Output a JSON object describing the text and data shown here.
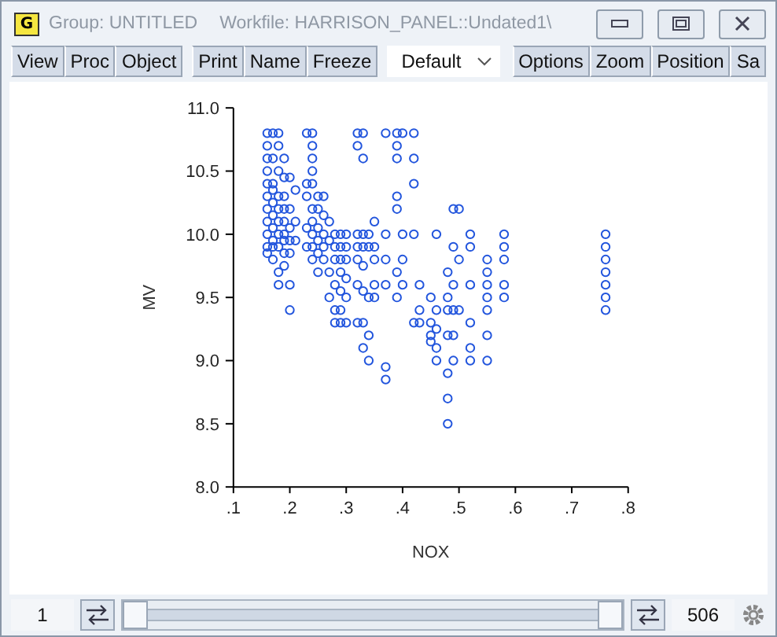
{
  "window": {
    "app_badge": "G",
    "title": "Group: UNTITLED",
    "workfile": "Workfile: HARRISON_PANEL::Undated1\\"
  },
  "toolbar": {
    "groups": [
      [
        {
          "label": "View"
        },
        {
          "label": "Proc"
        },
        {
          "label": "Object"
        }
      ],
      [
        {
          "label": "Print"
        },
        {
          "label": "Name"
        },
        {
          "label": "Freeze"
        }
      ]
    ],
    "dropdown": {
      "value": "Default"
    },
    "right": [
      {
        "label": "Options"
      },
      {
        "label": "Zoom"
      },
      {
        "label": "Position"
      },
      {
        "label": "Sa"
      }
    ]
  },
  "graph": {
    "chart_data": {
      "type": "scatter",
      "xlabel": "NOX",
      "ylabel": "MV",
      "xlim": [
        0.1,
        0.8
      ],
      "ylim": [
        8.0,
        11.0
      ],
      "xticks": [
        {
          "value": 0.1,
          "label": ".1"
        },
        {
          "value": 0.2,
          "label": ".2"
        },
        {
          "value": 0.3,
          "label": ".3"
        },
        {
          "value": 0.4,
          "label": ".4"
        },
        {
          "value": 0.5,
          "label": ".5"
        },
        {
          "value": 0.6,
          "label": ".6"
        },
        {
          "value": 0.7,
          "label": ".7"
        },
        {
          "value": 0.8,
          "label": ".8"
        }
      ],
      "yticks": [
        {
          "value": 8.0,
          "label": "8.0"
        },
        {
          "value": 8.5,
          "label": "8.5"
        },
        {
          "value": 9.0,
          "label": "9.0"
        },
        {
          "value": 9.5,
          "label": "9.5"
        },
        {
          "value": 10.0,
          "label": "10.0"
        },
        {
          "value": 10.5,
          "label": "10.5"
        },
        {
          "value": 11.0,
          "label": "11.0"
        }
      ],
      "x": [
        0.16,
        0.16,
        0.16,
        0.16,
        0.16,
        0.16,
        0.16,
        0.16,
        0.16,
        0.16,
        0.16,
        0.17,
        0.17,
        0.17,
        0.17,
        0.17,
        0.17,
        0.17,
        0.17,
        0.17,
        0.17,
        0.18,
        0.18,
        0.18,
        0.18,
        0.18,
        0.18,
        0.18,
        0.18,
        0.18,
        0.18,
        0.19,
        0.19,
        0.19,
        0.19,
        0.19,
        0.19,
        0.19,
        0.19,
        0.19,
        0.2,
        0.2,
        0.2,
        0.2,
        0.2,
        0.2,
        0.2,
        0.21,
        0.21,
        0.21,
        0.23,
        0.23,
        0.23,
        0.23,
        0.23,
        0.24,
        0.24,
        0.24,
        0.24,
        0.24,
        0.24,
        0.24,
        0.24,
        0.24,
        0.24,
        0.25,
        0.25,
        0.25,
        0.25,
        0.25,
        0.25,
        0.26,
        0.26,
        0.26,
        0.26,
        0.26,
        0.27,
        0.27,
        0.27,
        0.27,
        0.28,
        0.28,
        0.28,
        0.28,
        0.28,
        0.28,
        0.29,
        0.29,
        0.29,
        0.29,
        0.29,
        0.29,
        0.29,
        0.3,
        0.3,
        0.3,
        0.3,
        0.3,
        0.3,
        0.32,
        0.32,
        0.32,
        0.32,
        0.32,
        0.32,
        0.32,
        0.33,
        0.33,
        0.33,
        0.33,
        0.33,
        0.33,
        0.33,
        0.33,
        0.34,
        0.34,
        0.34,
        0.34,
        0.34,
        0.35,
        0.35,
        0.35,
        0.35,
        0.35,
        0.37,
        0.37,
        0.37,
        0.37,
        0.37,
        0.37,
        0.39,
        0.39,
        0.39,
        0.39,
        0.39,
        0.39,
        0.39,
        0.4,
        0.4,
        0.4,
        0.4,
        0.42,
        0.42,
        0.42,
        0.42,
        0.42,
        0.43,
        0.43,
        0.43,
        0.45,
        0.45,
        0.45,
        0.45,
        0.46,
        0.46,
        0.46,
        0.46,
        0.46,
        0.48,
        0.48,
        0.48,
        0.48,
        0.48,
        0.48,
        0.48,
        0.49,
        0.49,
        0.49,
        0.49,
        0.49,
        0.49,
        0.5,
        0.5,
        0.5,
        0.52,
        0.52,
        0.52,
        0.52,
        0.52,
        0.52,
        0.55,
        0.55,
        0.55,
        0.55,
        0.55,
        0.55,
        0.55,
        0.58,
        0.58,
        0.58,
        0.58,
        0.58,
        0.76,
        0.76,
        0.76,
        0.76,
        0.76,
        0.76,
        0.76
      ],
      "series": [
        {
          "color": "#2255dd",
          "values": [
            10.8,
            10.7,
            10.6,
            10.5,
            10.4,
            10.3,
            10.2,
            10.1,
            10.0,
            9.9,
            9.85,
            10.8,
            10.6,
            10.4,
            10.35,
            10.25,
            10.15,
            10.05,
            9.95,
            9.9,
            9.8,
            10.8,
            10.7,
            10.5,
            10.3,
            10.2,
            10.1,
            10.0,
            9.9,
            9.7,
            9.6,
            10.6,
            10.45,
            10.3,
            10.2,
            10.1,
            10.0,
            9.95,
            9.85,
            9.75,
            10.45,
            10.2,
            10.05,
            9.95,
            9.85,
            9.6,
            9.4,
            10.35,
            10.1,
            9.95,
            10.8,
            10.4,
            10.3,
            10.05,
            9.9,
            10.8,
            10.7,
            10.6,
            10.5,
            10.4,
            10.2,
            10.1,
            10.0,
            9.9,
            9.8,
            10.3,
            10.2,
            10.05,
            9.95,
            9.85,
            9.7,
            10.3,
            10.15,
            10.0,
            9.9,
            9.8,
            10.1,
            9.95,
            9.7,
            9.5,
            10.0,
            9.9,
            9.8,
            9.6,
            9.4,
            9.3,
            10.0,
            9.9,
            9.8,
            9.7,
            9.55,
            9.4,
            9.3,
            10.0,
            9.9,
            9.8,
            9.65,
            9.5,
            9.3,
            10.8,
            10.7,
            10.0,
            9.9,
            9.8,
            9.6,
            9.3,
            10.8,
            10.6,
            10.0,
            9.9,
            9.75,
            9.55,
            9.3,
            9.1,
            10.0,
            9.9,
            9.5,
            9.2,
            9.0,
            10.1,
            9.9,
            9.8,
            9.6,
            9.5,
            10.8,
            10.0,
            9.8,
            9.6,
            8.95,
            8.85,
            10.8,
            10.7,
            10.6,
            10.3,
            10.2,
            9.7,
            9.5,
            10.8,
            10.0,
            9.8,
            9.6,
            10.8,
            10.6,
            10.4,
            10.0,
            9.3,
            9.6,
            9.4,
            9.3,
            9.5,
            9.3,
            9.2,
            9.15,
            10.0,
            9.4,
            9.25,
            9.1,
            9.0,
            9.7,
            9.5,
            9.4,
            9.2,
            8.9,
            8.7,
            8.5,
            10.2,
            9.9,
            9.6,
            9.4,
            9.2,
            9.0,
            10.2,
            9.8,
            9.4,
            10.0,
            9.9,
            9.6,
            9.3,
            9.1,
            9.0,
            9.8,
            9.7,
            9.6,
            9.5,
            9.4,
            9.2,
            9.0,
            10.0,
            9.9,
            9.8,
            9.6,
            9.5,
            10.0,
            9.9,
            9.8,
            9.7,
            9.6,
            9.5,
            9.4
          ]
        }
      ]
    }
  },
  "sample": {
    "start": "1",
    "end": "506"
  }
}
